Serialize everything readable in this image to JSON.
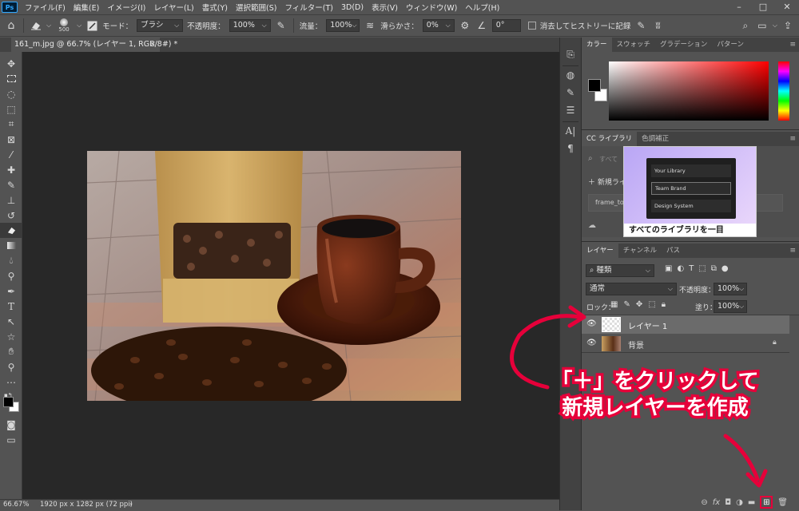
{
  "menubar": {
    "logo": "Ps",
    "items": [
      "ファイル(F)",
      "編集(E)",
      "イメージ(I)",
      "レイヤー(L)",
      "書式(Y)",
      "選択範囲(S)",
      "フィルター(T)",
      "3D(D)",
      "表示(V)",
      "ウィンドウ(W)",
      "ヘルプ(H)"
    ],
    "minimize": "–",
    "maximize": "□",
    "close": "✕"
  },
  "options": {
    "brush_size": "500",
    "mode_label": "モード：",
    "mode_value": "ブラシ",
    "opacity_label": "不透明度：",
    "opacity_value": "100%",
    "flow_label": "流量：",
    "flow_value": "100%",
    "smoothing_label": "滑らかさ：",
    "smoothing_value": "0%",
    "angle_value": "0°",
    "erase_history_label": "消去してヒストリーに記録"
  },
  "document": {
    "tab_title": "161_m.jpg @ 66.7% (レイヤー 1, RGB/8#) *",
    "close": "×",
    "collapse": "▹▹"
  },
  "status": {
    "zoom": "66.67%",
    "info": "1920 px x 1282 px (72 ppi)",
    "arrow": "›"
  },
  "color_panel": {
    "tabs": [
      "カラー",
      "スウォッチ",
      "グラデーション",
      "パターン"
    ],
    "active": 0
  },
  "library_panel": {
    "tabs": [
      "CC ライブラリ",
      "色調補正"
    ],
    "active": 0,
    "search_placeholder": "すべて",
    "new_library": "新規ライ",
    "item1": "frame_top",
    "popup_items": [
      "Your Library",
      "Team Brand",
      "Design System"
    ],
    "popup_caption": "すべてのライブラリを一目"
  },
  "layers_panel": {
    "tabs": [
      "レイヤー",
      "チャンネル",
      "パス"
    ],
    "active": 0,
    "filter_kind": "種類",
    "blend_mode": "通常",
    "opacity_label": "不透明度：",
    "opacity_value": "100%",
    "lock_label": "ロック：",
    "fill_label": "塗り：",
    "fill_value": "100%",
    "layers": [
      {
        "name": "レイヤー 1",
        "selected": true
      },
      {
        "name": "背景",
        "selected": false
      }
    ]
  },
  "annotation": {
    "line1": "「＋」をクリックして",
    "line2": "新規レイヤーを作成",
    "color": "#e6003a"
  },
  "colors": {
    "accent": "#e6003a",
    "ui_bg": "#535353",
    "canvas_bg": "#282828",
    "selected_layer": "#6b6b6b",
    "hue_gradient": "#ff0000"
  }
}
